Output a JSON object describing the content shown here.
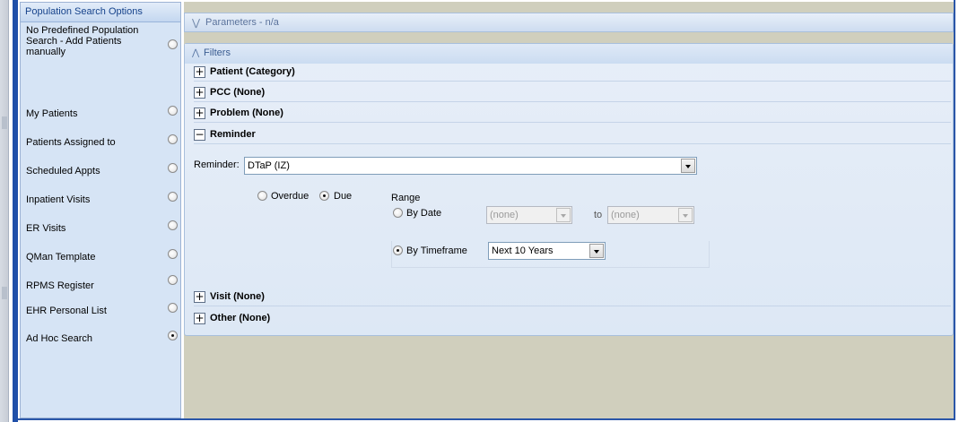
{
  "options_panel": {
    "title": "Population Search Options",
    "items": [
      {
        "label": "No Predefined Population Search - Add Patients manually",
        "selected": false
      },
      {
        "label": "My Patients",
        "selected": false
      },
      {
        "label": "Patients Assigned to",
        "selected": false
      },
      {
        "label": "Scheduled Appts",
        "selected": false
      },
      {
        "label": "Inpatient Visits",
        "selected": false
      },
      {
        "label": "ER Visits",
        "selected": false
      },
      {
        "label": "QMan Template",
        "selected": false
      },
      {
        "label": "RPMS Register",
        "selected": false
      },
      {
        "label": "EHR Personal List",
        "selected": false
      },
      {
        "label": "Ad Hoc Search",
        "selected": true
      }
    ]
  },
  "parameters": {
    "title": "Parameters - n/a",
    "expanded": false
  },
  "filters": {
    "title": "Filters",
    "sections": [
      {
        "label": "Patient (Category)",
        "expander": "+"
      },
      {
        "label": "PCC (None)",
        "expander": "+"
      },
      {
        "label": "Problem (None)",
        "expander": "+"
      },
      {
        "label": "Reminder",
        "expander": "−"
      },
      {
        "label": "Visit (None)",
        "expander": "+"
      },
      {
        "label": "Other (None)",
        "expander": "+"
      }
    ],
    "reminder": {
      "label": "Reminder:",
      "value": "DTaP (IZ)",
      "status_options": [
        {
          "label": "Overdue",
          "selected": false
        },
        {
          "label": "Due",
          "selected": true
        }
      ],
      "range_label": "Range",
      "by_date": {
        "label": "By Date",
        "selected": false,
        "from": "(none)",
        "to_label": "to",
        "to": "(none)"
      },
      "by_timeframe": {
        "label": "By Timeframe",
        "selected": true,
        "value": "Next 10 Years"
      }
    }
  },
  "colors": {
    "accent_blue": "#1f4fa8",
    "panel_bg": "#d6e4f5",
    "main_bg": "#d0cfbd",
    "header_text": "#15428b"
  }
}
